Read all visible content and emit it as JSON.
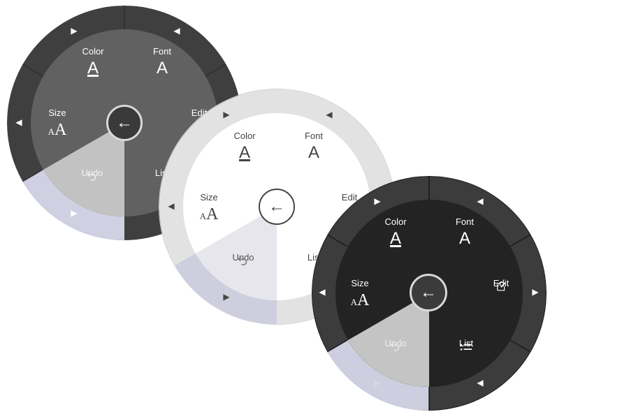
{
  "menus": [
    {
      "theme": "dark-gray",
      "items": {
        "color": {
          "label": "Color"
        },
        "font": {
          "label": "Font"
        },
        "size": {
          "label": "Size"
        },
        "edit": {
          "label": "Edit"
        },
        "undo": {
          "label": "Undo"
        },
        "list": {
          "label": "List"
        }
      },
      "back_icon": "arrow-left-icon"
    },
    {
      "theme": "light",
      "items": {
        "color": {
          "label": "Color"
        },
        "font": {
          "label": "Font"
        },
        "size": {
          "label": "Size"
        },
        "edit": {
          "label": "Edit"
        },
        "undo": {
          "label": "Undo"
        },
        "list": {
          "label": "List"
        }
      },
      "back_icon": "arrow-left-icon"
    },
    {
      "theme": "black",
      "items": {
        "color": {
          "label": "Color"
        },
        "font": {
          "label": "Font"
        },
        "size": {
          "label": "Size"
        },
        "edit": {
          "label": "Edit"
        },
        "undo": {
          "label": "Undo"
        },
        "list": {
          "label": "List"
        }
      },
      "back_icon": "arrow-left-icon"
    }
  ],
  "glyphs": {
    "color": "A",
    "font": "A",
    "size_small": "A",
    "size_large": "A",
    "back": "←"
  },
  "colors": {
    "selected_sector": "#c9cbdc",
    "undo_sector_light": "#c4c4c4"
  }
}
